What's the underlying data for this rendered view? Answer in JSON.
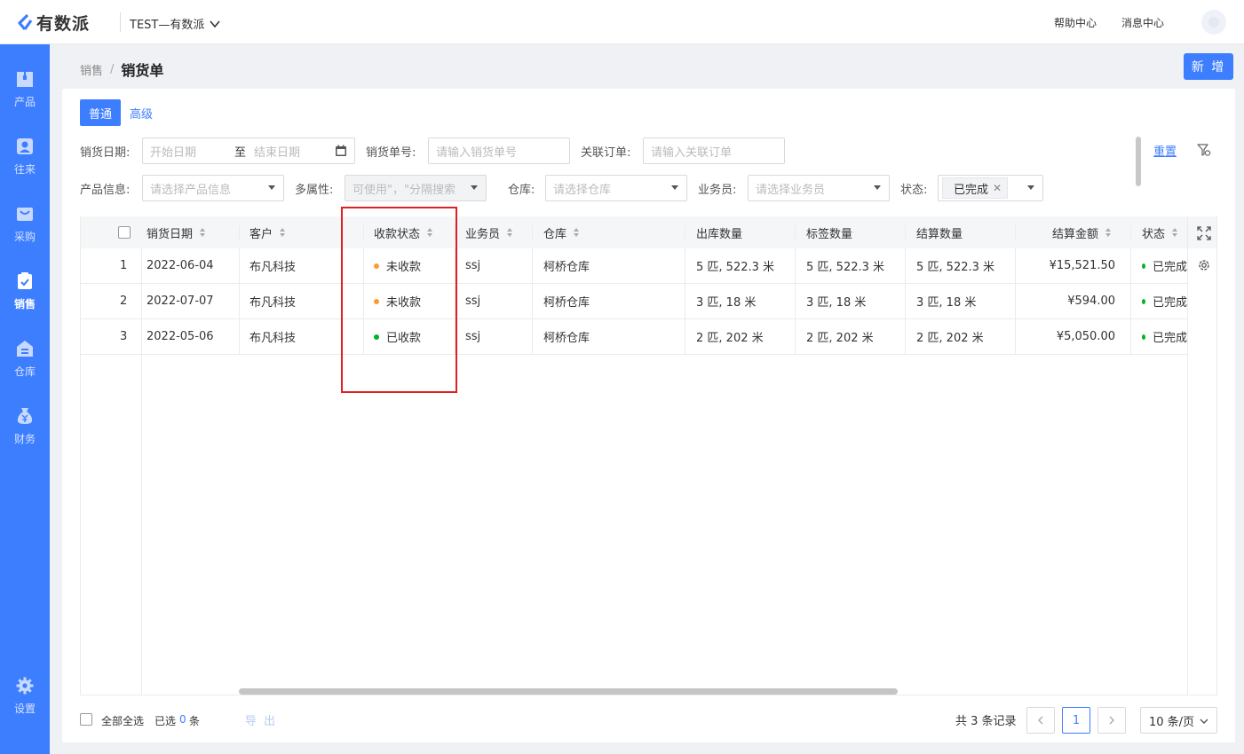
{
  "brand": {
    "name": "有数派",
    "accent": "#3d7eff"
  },
  "tenant": {
    "label": "TEST—有数派"
  },
  "top_links": {
    "help": "帮助中心",
    "messages": "消息中心"
  },
  "sidebar": {
    "items": [
      {
        "label": "产品",
        "icon": "box-icon"
      },
      {
        "label": "往来",
        "icon": "contacts-icon"
      },
      {
        "label": "采购",
        "icon": "cart-icon"
      },
      {
        "label": "销售",
        "icon": "clipboard-icon",
        "active": true
      },
      {
        "label": "仓库",
        "icon": "warehouse-icon"
      },
      {
        "label": "财务",
        "icon": "money-bag-icon"
      },
      {
        "label": "设置",
        "icon": "gear-icon"
      }
    ]
  },
  "breadcrumb": {
    "parent": "销售",
    "separator": "/",
    "current": "销货单"
  },
  "actions": {
    "new_label": "新 增"
  },
  "search_tabs": [
    {
      "label": "普通",
      "active": true
    },
    {
      "label": "高级",
      "active": false
    }
  ],
  "filters": {
    "date_label": "销货日期:",
    "date_start_placeholder": "开始日期",
    "date_to": "至",
    "date_end_placeholder": "结束日期",
    "order_no_label": "销货单号:",
    "order_no_placeholder": "请输入销货单号",
    "related_label": "关联订单:",
    "related_placeholder": "请输入关联订单",
    "product_label": "产品信息:",
    "product_placeholder": "请选择产品信息",
    "attr_label": "多属性:",
    "attr_placeholder": "可使用\"，\"分隔搜索",
    "warehouse_label": "仓库:",
    "warehouse_placeholder": "请选择仓库",
    "salesman_label": "业务员:",
    "salesman_placeholder": "请选择业务员",
    "status_label": "状态:",
    "status_tag": "已完成",
    "reset_label": "重置"
  },
  "table": {
    "headers": {
      "date": "销货日期",
      "customer": "客户",
      "payment_status": "收款状态",
      "salesman": "业务员",
      "warehouse": "仓库",
      "out_qty": "出库数量",
      "label_qty": "标签数量",
      "settle_qty": "结算数量",
      "settle_amount": "结算金额",
      "status": "状态"
    },
    "rows": [
      {
        "index": "1",
        "date": "2022-06-04",
        "customer": "布凡科技",
        "payment_status": "未收款",
        "payment_color": "#ff9a2e",
        "salesman": "ssj",
        "warehouse": "柯桥仓库",
        "out_qty": "5 匹, 522.3 米",
        "label_qty": "5 匹, 522.3 米",
        "settle_qty": "5 匹, 522.3 米",
        "settle_amount": "¥15,521.50",
        "status": "已完成"
      },
      {
        "index": "2",
        "date": "2022-07-07",
        "customer": "布凡科技",
        "payment_status": "未收款",
        "payment_color": "#ff9a2e",
        "salesman": "ssj",
        "warehouse": "柯桥仓库",
        "out_qty": "3 匹, 18 米",
        "label_qty": "3 匹, 18 米",
        "settle_qty": "3 匹, 18 米",
        "settle_amount": "¥594.00",
        "status": "已完成"
      },
      {
        "index": "3",
        "date": "2022-05-06",
        "customer": "布凡科技",
        "payment_status": "已收款",
        "payment_color": "#00b42a",
        "salesman": "ssj",
        "warehouse": "柯桥仓库",
        "out_qty": "2 匹, 202 米",
        "label_qty": "2 匹, 202 米",
        "settle_qty": "2 匹, 202 米",
        "settle_amount": "¥5,050.00",
        "status": "已完成"
      }
    ],
    "status_color": "#00b42a"
  },
  "footer": {
    "select_all": "全部全选",
    "selected_prefix": "已选",
    "selected_count": "0",
    "selected_suffix": "条",
    "export_label": "导 出",
    "total": "共 3 条记录",
    "current_page": "1",
    "page_size": "10 条/页"
  }
}
